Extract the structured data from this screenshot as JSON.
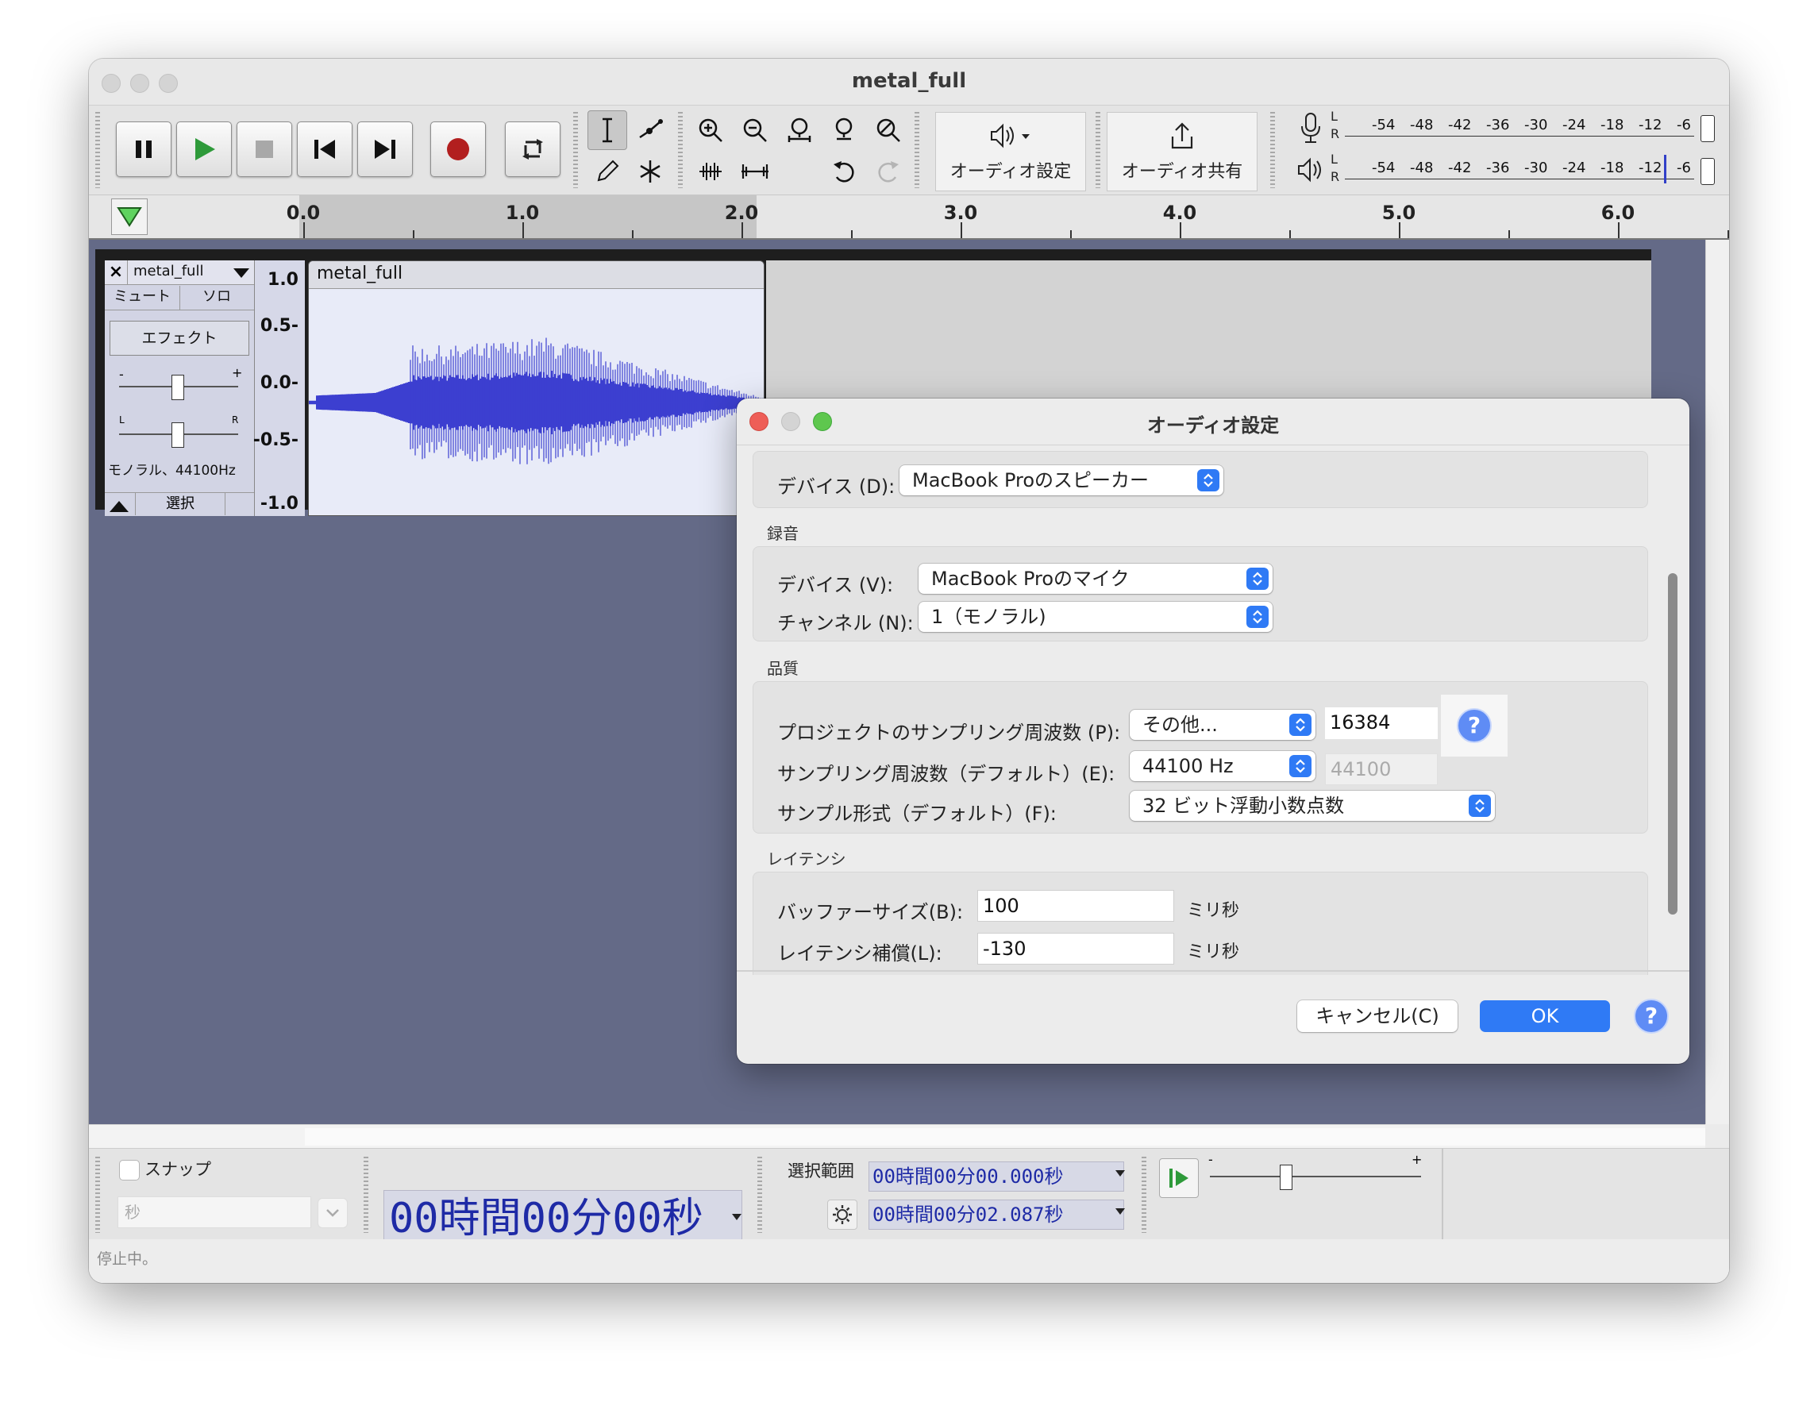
{
  "window": {
    "title": "metal_full"
  },
  "toolbar": {
    "audio_setup_label": "オーディオ設定",
    "audio_share_label": "オーディオ共有",
    "meter_ticks": [
      "-54",
      "-48",
      "-42",
      "-36",
      "-30",
      "-24",
      "-18",
      "-12",
      "-6"
    ],
    "meter_lr": {
      "L": "L",
      "R": "R"
    }
  },
  "ruler": {
    "labels": [
      "0.0",
      "1.0",
      "2.0",
      "3.0",
      "4.0",
      "5.0",
      "6.0"
    ]
  },
  "track": {
    "name": "metal_full",
    "mute_label": "ミュート",
    "solo_label": "ソロ",
    "effects_label": "エフェクト",
    "gain_minus": "-",
    "gain_plus": "+",
    "pan_left": "L",
    "pan_right": "R",
    "info": "モノラル、44100Hz",
    "select_label": "選択",
    "scale": [
      "1.0",
      "0.5-",
      "0.0-",
      "-0.5-",
      "-1.0"
    ],
    "clip_name": "metal_full"
  },
  "bottom": {
    "snap_label": "スナップ",
    "snap_unit": "秒",
    "time_display": "00時間00分00秒",
    "selection_label": "選択範囲",
    "sel_start": "00時間00分00.000秒",
    "sel_end": "00時間00分02.087秒",
    "speed_minus": "-",
    "speed_plus": "+",
    "status": "停止中。"
  },
  "dialog": {
    "title": "オーディオ設定",
    "playback_device_label": "デバイス (D):",
    "playback_device_value": "MacBook Proのスピーカー",
    "recording_section": "録音",
    "rec_device_label": "デバイス (V):",
    "rec_device_value": "MacBook Proのマイク",
    "channels_label": "チャンネル (N):",
    "channels_value": "1（モノラル)",
    "quality_section": "品質",
    "project_rate_label": "プロジェクトのサンプリング周波数 (P):",
    "project_rate_choice": "その他...",
    "project_rate_value": "16384",
    "default_rate_label": "サンプリング周波数（デフォルト）(E):",
    "default_rate_choice": "44100 Hz",
    "default_rate_value": "44100",
    "sample_format_label": "サンプル形式（デフォルト）(F):",
    "sample_format_value": "32 ビット浮動小数点数",
    "latency_section": "レイテンシ",
    "buffer_label": "バッファーサイズ(B):",
    "buffer_value": "100",
    "buffer_unit": "ミリ秒",
    "latency_comp_label": "レイテンシ補償(L):",
    "latency_comp_value": "-130",
    "latency_unit": "ミリ秒",
    "cancel_label": "キャンセル(C)",
    "ok_label": "OK",
    "help_label": "?"
  },
  "colors": {
    "accent": "#2f7af5",
    "waveform": "#3c3fd0",
    "track_bg": "#646a87",
    "record": "#b21f1f",
    "play": "#2e9a3a"
  }
}
